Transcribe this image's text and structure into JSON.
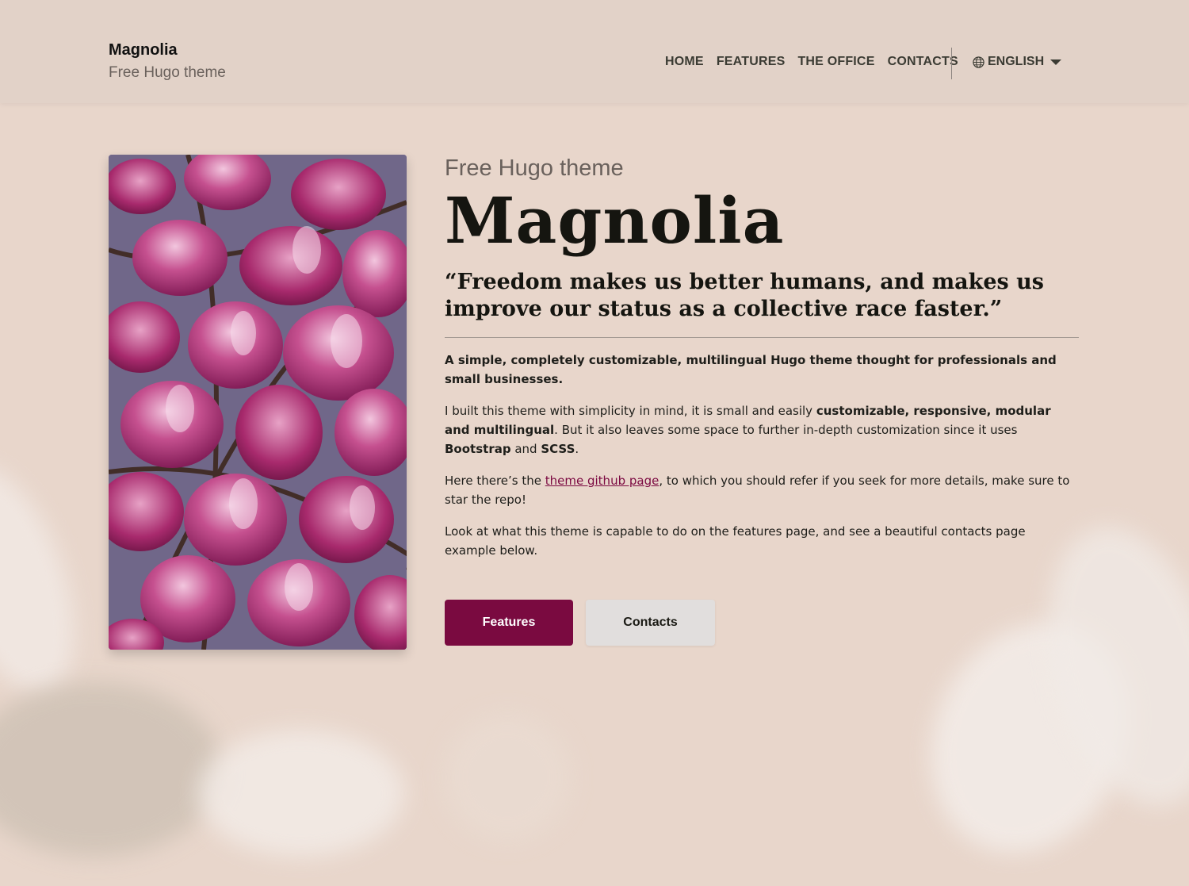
{
  "header": {
    "brand_name": "Magnolia",
    "brand_tagline": "Free Hugo theme",
    "nav": [
      "HOME",
      "FEATURES",
      "THE OFFICE",
      "CONTACTS"
    ],
    "language": "ENGLISH"
  },
  "hero": {
    "image_icon": "magnolia-flowers-photo",
    "subtitle": "Free Hugo theme",
    "title": "Magnolia",
    "quote": "“Freedom makes us better humans, and makes us improve our status as a collective race faster.”",
    "intro": "A simple, completely customizable, multilingual Hugo theme thought for professionals and small businesses.",
    "p1": {
      "t1": "I built this theme with simplicity in mind, it is small and easily ",
      "b1": "customizable, responsive, modular and multilingual",
      "t2": ". But it also leaves some space to further in-depth customization since it uses ",
      "b2": "Bootstrap",
      "t3": " and ",
      "b3": "SCSS",
      "t4": "."
    },
    "p2": {
      "t1": "Here there’s the ",
      "link": "theme github page",
      "t2": ", to which you should refer if you seek for more details, make sure to star the repo!"
    },
    "p3": "Look at what this theme is capable to do on the features page, and see a beautiful contacts page example below.",
    "buttons": {
      "primary": "Features",
      "secondary": "Contacts"
    }
  },
  "colors": {
    "background": "#e8d6cb",
    "header": "#e2d2c8",
    "accent": "#7a0a40",
    "link": "#7c0a42"
  }
}
